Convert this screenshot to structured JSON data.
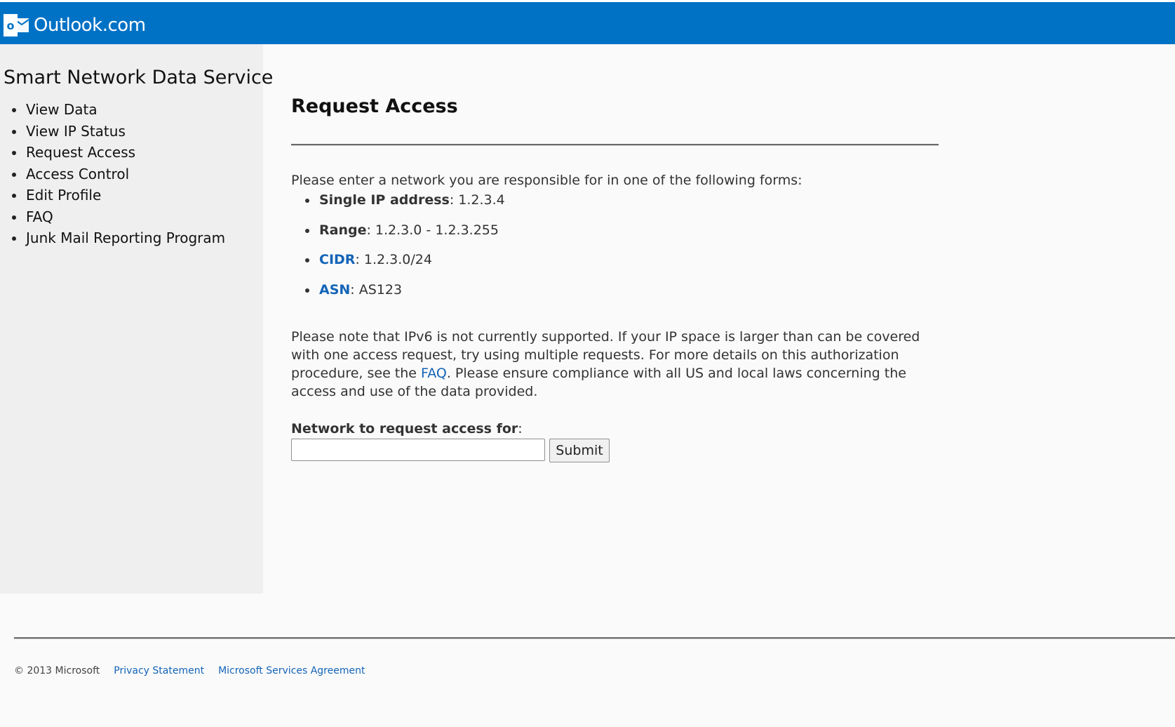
{
  "header": {
    "brand": "Outlook.com",
    "logo_icon": "outlook-logo-icon",
    "logo_letter": "o",
    "background_color": "#0072c6"
  },
  "sidebar": {
    "title": "Smart Network Data Service",
    "items": [
      {
        "label": "View Data"
      },
      {
        "label": "View IP Status"
      },
      {
        "label": "Request Access"
      },
      {
        "label": "Access Control"
      },
      {
        "label": "Edit Profile"
      },
      {
        "label": "FAQ"
      },
      {
        "label": "Junk Mail Reporting Program"
      }
    ]
  },
  "main": {
    "title": "Request Access",
    "intro": "Please enter a network you are responsible for in one of the following forms:",
    "forms": [
      {
        "term": "Single IP address",
        "example": ": 1.2.3.4"
      },
      {
        "term": "Range",
        "example": ": 1.2.3.0 - 1.2.3.255"
      },
      {
        "term": "CIDR",
        "example": ": 1.2.3.0/24"
      },
      {
        "term": "ASN",
        "example": ": AS123"
      }
    ],
    "note": {
      "part1": "Please note that IPv6 is not currently supported.  If your IP space is larger than can be covered with one access request, try using multiple requests.  For more details on this authorization procedure, see the ",
      "faq_link": "FAQ",
      "part2": ".  Please ensure compliance with all US and local laws concerning the access and use of the data provided."
    },
    "field_label": "Network to request access for",
    "field_label_suffix": ":",
    "input_value": "",
    "submit_label": "Submit",
    "link_color": "#1464b8"
  },
  "footer": {
    "copyright": "© 2013 Microsoft",
    "links": [
      {
        "label": "Privacy Statement"
      },
      {
        "label": "Microsoft Services Agreement"
      }
    ]
  }
}
